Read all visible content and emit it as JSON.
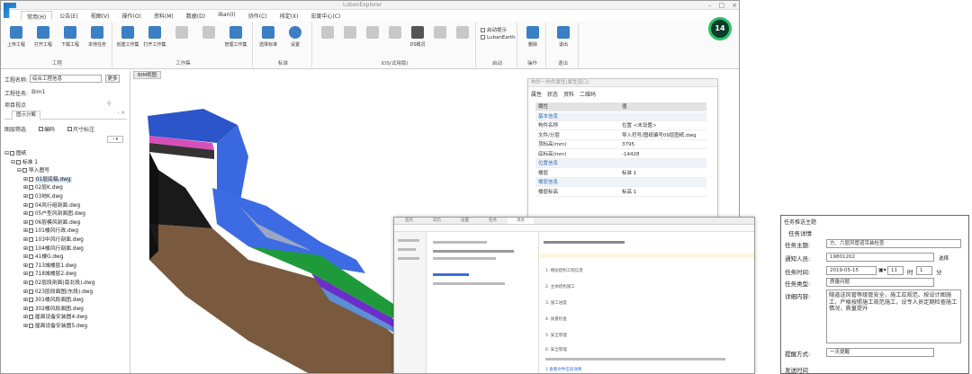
{
  "main_window": {
    "title": "LubanExplorer",
    "win_controls": [
      "–",
      "□",
      "×"
    ],
    "tabs": [
      "常用(H)",
      "公告(E)",
      "视图(V)",
      "操作(O)",
      "资料(M)",
      "数据(D)",
      "iBan(I)",
      "协作(C)",
      "排定(X)",
      "宏度中心(C)"
    ],
    "ribbon": {
      "groups": [
        {
          "label": "工程",
          "buttons": [
            "上传工程",
            "打开工程",
            "下载工程",
            "本地任务"
          ]
        },
        {
          "label": "工作集",
          "buttons": [
            "创建工作集",
            "打开工作集",
            "",
            "",
            "管理工作集"
          ]
        },
        {
          "label": "标准",
          "buttons": [
            "选择标准",
            "设置"
          ]
        },
        {
          "label": "iDS(试用版)",
          "buttons": [
            "",
            "",
            "",
            "",
            "DS概况",
            "",
            ""
          ]
        },
        {
          "label": "启动",
          "checkboxes": [
            "启动提示",
            "LubanEarth"
          ]
        },
        {
          "label": "操作",
          "buttons": [
            "删除"
          ]
        },
        {
          "label": "退出",
          "buttons": [
            "退出"
          ]
        }
      ]
    },
    "badge_count": "14",
    "left_panel": {
      "project_label": "工程名称:",
      "project_value": "综合工程信息",
      "project_btn": "更多",
      "task_label": "工程任务:",
      "task_value": "Bim1",
      "section_label": "项目视点",
      "panel_tab": "图示分解",
      "toolbar": [
        "图层筛选",
        "编码",
        "尺寸标注"
      ],
      "tree": [
        {
          "indent": 0,
          "text": "图纸"
        },
        {
          "indent": 1,
          "text": "标准 1"
        },
        {
          "indent": 2,
          "text": "导入图号"
        },
        {
          "indent": 3,
          "text": "01层底稿.dwg",
          "hl": true
        },
        {
          "indent": 3,
          "text": "02层K.dwg"
        },
        {
          "indent": 3,
          "text": "03地K.dwg"
        },
        {
          "indent": 3,
          "text": "04风行组剖面.dwg"
        },
        {
          "indent": 3,
          "text": "05户型风剖面图.dwg"
        },
        {
          "indent": 3,
          "text": "06层模风剖面.dwg"
        },
        {
          "indent": 3,
          "text": "101楼风行政.dwg"
        },
        {
          "indent": 3,
          "text": "103中风行剖面.dwg"
        },
        {
          "indent": 3,
          "text": "104楼风行剖面.dwg"
        },
        {
          "indent": 3,
          "text": "41楼G.dwg"
        },
        {
          "indent": 3,
          "text": "713城楼层1.dwg"
        },
        {
          "indent": 3,
          "text": "718城楼层2.dwg"
        },
        {
          "indent": 3,
          "text": "02层段剖面(南北段).dwg"
        },
        {
          "indent": 3,
          "text": "023层段面图(东段).dwg"
        },
        {
          "indent": 3,
          "text": "301楼风段面图.dwg"
        },
        {
          "indent": 3,
          "text": "302楼风段面图.dwg"
        },
        {
          "indent": 3,
          "text": "屋面设备安装图4.dwg"
        },
        {
          "indent": 3,
          "text": "屋面设备安装图5.dwg"
        }
      ]
    },
    "view_tab": "BIM视图",
    "properties": {
      "title": "构件一构件属性(属性窗口)",
      "tabs": [
        "属性",
        "状态",
        "资料",
        "二维码"
      ],
      "rows": [
        {
          "k": "属性",
          "v": "值",
          "type": "head"
        },
        {
          "k": "基本信息",
          "v": "",
          "type": "sec"
        },
        {
          "k": "构件名称",
          "v": "位置 <未设置>",
          "type": ""
        },
        {
          "k": "文件/分层",
          "v": "导入符号/图纸编号09层图纸.dwg",
          "type": ""
        },
        {
          "k": "顶标高(mm)",
          "v": "3795",
          "type": ""
        },
        {
          "k": "底标高(mm)",
          "v": "-14428",
          "type": ""
        },
        {
          "k": "位置信息",
          "v": "",
          "type": "sec"
        },
        {
          "k": "楼层",
          "v": "标准 1",
          "type": ""
        },
        {
          "k": "楼层信息",
          "v": "",
          "type": "sec"
        },
        {
          "k": "楼层标高",
          "v": "标高 1",
          "type": ""
        }
      ]
    }
  },
  "second_window": {
    "tabs": [
      "首页",
      "日历",
      "设置",
      "任务",
      "消息"
    ],
    "items": [
      "1. 楼层结构工程信息",
      "2. 主体结构施工",
      "3. 施工进度",
      "4. 质量检查",
      "5. 安全管理",
      "6. 安全管理"
    ],
    "link": "1 查看文件信息详情"
  },
  "task_dialog": {
    "title": "任务推送主题",
    "section": "任务详情",
    "fields": [
      {
        "label": "任务主题:",
        "value": "方、六层风管道吊装检查"
      },
      {
        "label": "通知人员:",
        "value": "19801202",
        "extra": "选择"
      },
      {
        "label": "任务时间:",
        "value": "2019-05-15",
        "time_h": "11",
        "time_m": "1",
        "unit_h": "时",
        "unit_m": "分"
      },
      {
        "label": "任务类型:",
        "value": "质量问题"
      }
    ],
    "content_label": "详细内容:",
    "content": "隧道送风管等级管安全、施工应规范、按设计图施工，严格按照施工规范施工，设专人员定期检查施工情况，质量提升",
    "remind_label": "提醒方式:",
    "remind_value": "一天提醒",
    "bottom_label": "发送时间"
  }
}
